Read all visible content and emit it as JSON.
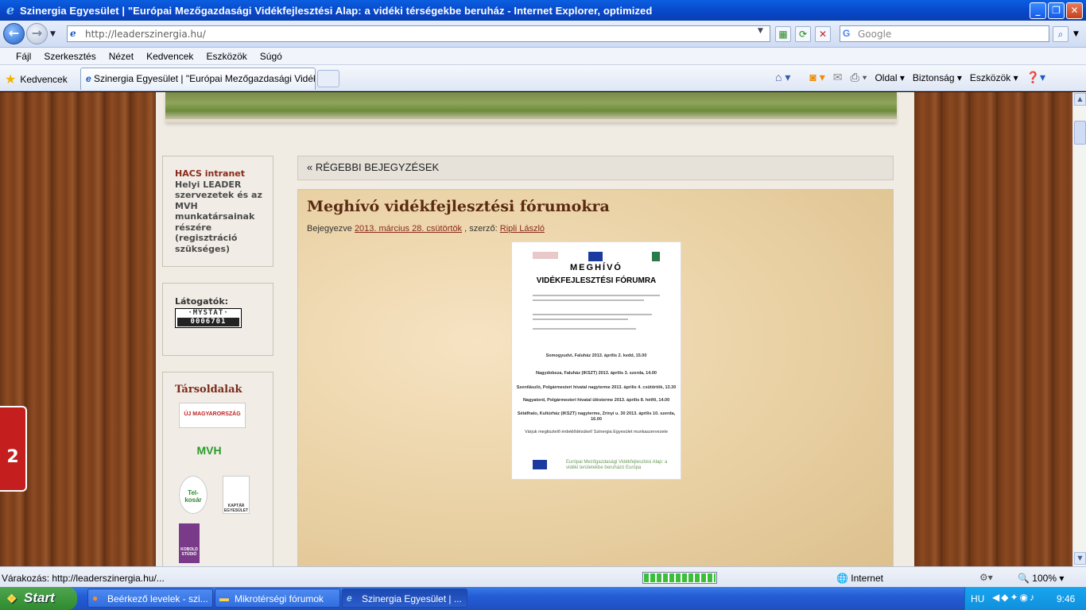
{
  "window": {
    "title": "Szinergia Egyesület | \"Európai Mezőgazdasági Vidékfejlesztési Alap: a vidéki térségekbe beruház - Internet Explorer, optimized",
    "min": "_",
    "max": "❐",
    "close": "✕"
  },
  "address": {
    "url": "http://leaderszinergia.hu/",
    "search_placeholder": "Google"
  },
  "menu": [
    "Fájl",
    "Szerkesztés",
    "Nézet",
    "Kedvencek",
    "Eszközök",
    "Súgó"
  ],
  "favorites": {
    "label": "Kedvencek",
    "tab": "Szinergia Egyesület | \"Európai Mezőgazdasági Vidékfe..."
  },
  "commands": {
    "page": "Oldal",
    "safety": "Biztonság",
    "tools": "Eszközök"
  },
  "sidebar": {
    "hacs_link": "HACS intranet",
    "hacs_text": "Helyi LEADER szervezetek és az MVH munkatársainak részére (regisztráció szükséges)",
    "visitors_label": "Látogatók:",
    "mystat_label": "·MYSTAT·",
    "mystat_count": "0006701",
    "partners_title": "Társoldalak",
    "logo_umvp": "ÚJ MAGYARORSZÁG",
    "logo_mvh": "MVH",
    "logo_tel": "Tel-kosár",
    "logo_kaptar": "KAPTÁR EGYESÜLET",
    "logo_kobold": "KOBOLD STÚDIÓ"
  },
  "side_tab": "2",
  "post": {
    "older": "« RÉGEBBI BEJEGYZÉSEK",
    "title": "Meghívó vidékfejlesztési fórumokra",
    "meta_prefix": "Bejegyezve",
    "date": "2013. március 28. csütörtök",
    "meta_author_label": ", szerző:",
    "author": "Ripli László",
    "poster_h1": "MEGHÍVÓ",
    "poster_h2": "VIDÉKFEJLESZTÉSI FÓRUMRA",
    "poster_events": [
      "Somogyudvi, Faluház 2013. április 2. kedd, 15.00",
      "Nagydobsza, Faluház (IKSZT) 2013. április 3. szerda, 14.00",
      "Szentlászló, Polgármesteri hivatal nagyterme 2013. április 4. csütörtök, 13.30",
      "Nagyatord, Polgármesteri hivatal üléstermе 2013. április 8. hétfő, 14.00",
      "Sétáfhalo, Kultúrház (IKSZT) nagyterme, Zrínyi u. 30 2013. április 10. szerda, 16.00"
    ],
    "poster_closing": "Várjuk megtisztelő érdeklődésüket! Szinergia Egyesület munkaszervezete",
    "poster_footer": "Európai Mezőgazdasági Vidékfejlesztési Alap: a vidéki területekbe beruházó Európa"
  },
  "status": {
    "text": "Várakozás: http://leaderszinergia.hu/...",
    "zone": "Internet",
    "zoom": "100%"
  },
  "taskbar": {
    "start": "Start",
    "tasks": [
      "Beérkező levelek - szi...",
      "Mikrotérségi fórumok",
      "Szinergia Egyesület | ..."
    ],
    "lang": "HU",
    "clock": "9:46"
  }
}
